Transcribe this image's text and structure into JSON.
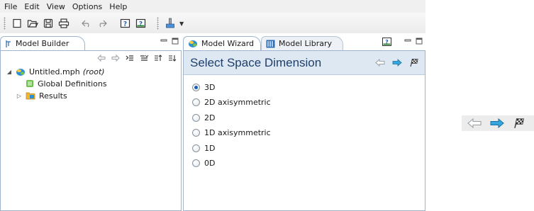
{
  "menubar": {
    "items": [
      "File",
      "Edit",
      "View",
      "Options",
      "Help"
    ]
  },
  "toolbar": {
    "icons": [
      "new-icon",
      "open-icon",
      "save-icon",
      "print-icon",
      "undo-icon",
      "redo-icon",
      "help-icon",
      "dynamic-help-icon",
      "windows-icon"
    ]
  },
  "builder": {
    "tab_label": "Model Builder",
    "tools": [
      "back-icon",
      "forward-icon",
      "show-icon",
      "collapse-icon",
      "move-up-icon",
      "move-down-icon"
    ],
    "tree": {
      "root_label": "Untitled.mph",
      "root_suffix": "(root)",
      "child_global": "Global Definitions",
      "child_results": "Results"
    }
  },
  "wizard": {
    "tab_label": "Model Wizard",
    "library_tab_label": "Model Library",
    "title": "Select Space Dimension",
    "options": [
      "3D",
      "2D axisymmetric",
      "2D",
      "1D axisymmetric",
      "1D",
      "0D"
    ],
    "selected": "3D"
  },
  "colors": {
    "accent": "#1f5db0",
    "title_text": "#1f3f6b",
    "header_bg": "#dde8f3",
    "nav_arrow": "#35a7e0"
  }
}
